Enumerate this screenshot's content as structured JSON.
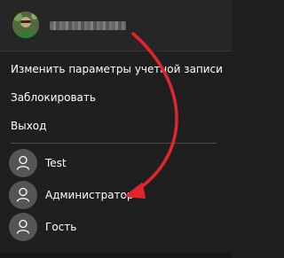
{
  "header": {
    "avatar_icon": "user-photo-avatar",
    "blurred_name_icon": "blurred-username"
  },
  "actions": {
    "change_account_settings": "Изменить параметры учетной записи",
    "lock": "Заблокировать",
    "sign_out": "Выход"
  },
  "users": [
    {
      "label": "Test",
      "icon": "user-silhouette-icon"
    },
    {
      "label": "Администратор",
      "icon": "user-silhouette-icon"
    },
    {
      "label": "Гость",
      "icon": "user-silhouette-icon"
    }
  ],
  "colors": {
    "background": "#1f1f1f",
    "header_background": "#262626",
    "text": "#ffffff",
    "avatar_gray": "#555555",
    "annotation_arrow": "#e0262b"
  },
  "annotation": {
    "icon": "red-curved-arrow"
  }
}
